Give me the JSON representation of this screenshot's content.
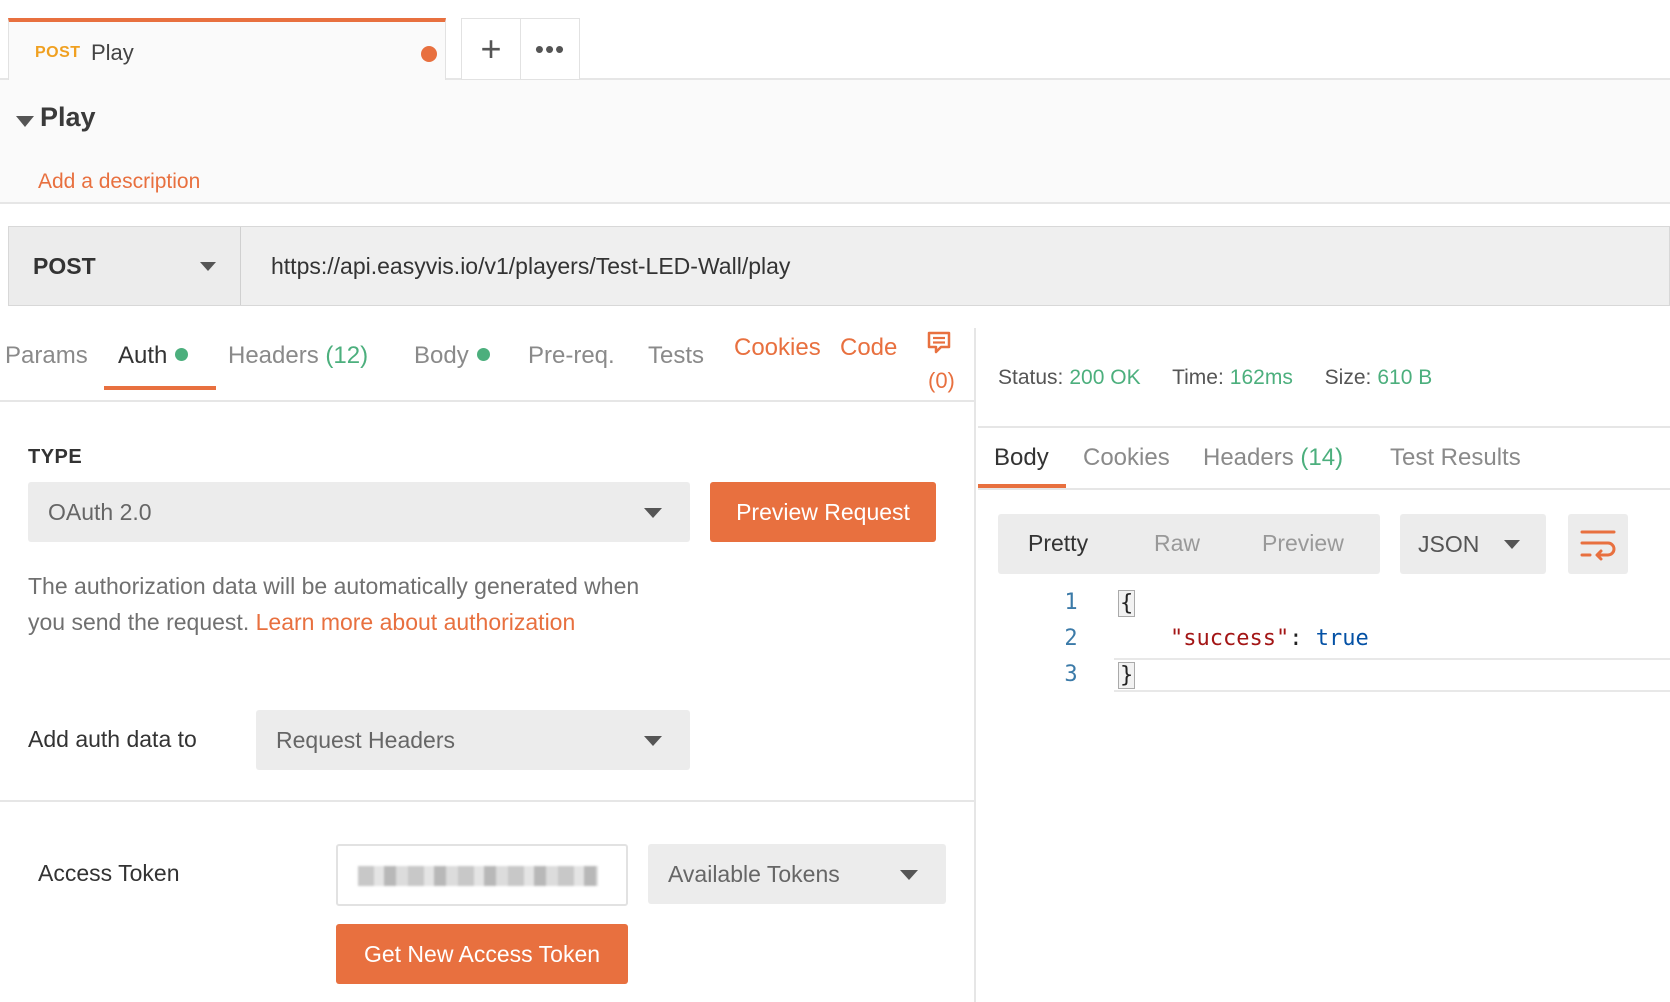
{
  "tab": {
    "method": "POST",
    "name": "Play"
  },
  "tab_actions": {
    "new_tab": "+",
    "more": "•••"
  },
  "request": {
    "title": "Play",
    "description_link": "Add a description",
    "method": "POST",
    "url": "https://api.easyvis.io/v1/players/Test-LED-Wall/play"
  },
  "request_tabs": {
    "params": "Params",
    "auth": "Auth",
    "headers": "Headers",
    "headers_count": "(12)",
    "body": "Body",
    "prereq": "Pre-req.",
    "tests": "Tests",
    "cookies": "Cookies",
    "code": "Code",
    "comments_count": "(0)"
  },
  "auth": {
    "type_label": "TYPE",
    "type_value": "OAuth 2.0",
    "preview_button": "Preview Request",
    "info_text": "The authorization data will be automatically generated when you send the request. ",
    "info_link": "Learn more about authorization",
    "add_to_label": "Add auth data to",
    "add_to_value": "Request Headers",
    "access_token_label": "Access Token",
    "available_tokens": "Available Tokens",
    "get_token_button": "Get New Access Token"
  },
  "response": {
    "status_label": "Status:",
    "status_value": "200 OK",
    "time_label": "Time:",
    "time_value": "162ms",
    "size_label": "Size:",
    "size_value": "610 B",
    "tabs": {
      "body": "Body",
      "cookies": "Cookies",
      "headers": "Headers",
      "headers_count": "(14)",
      "test_results": "Test Results"
    },
    "views": {
      "pretty": "Pretty",
      "raw": "Raw",
      "preview": "Preview"
    },
    "format": "JSON",
    "code": {
      "line_numbers": [
        "1",
        "2",
        "3"
      ],
      "open_brace": "{",
      "key": "\"success\"",
      "colon": ": ",
      "value": "true",
      "close_brace": "}"
    }
  },
  "colors": {
    "accent": "#e8703f",
    "success": "#4caf7d",
    "method_tab": "#f0a020"
  }
}
